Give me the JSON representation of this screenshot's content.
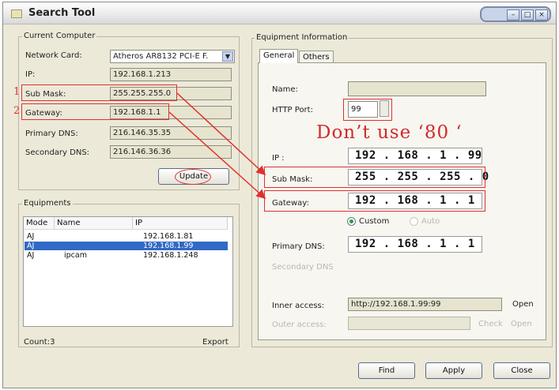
{
  "window": {
    "title": "Search Tool"
  },
  "current_computer": {
    "group_label": "Current Computer",
    "network_card_label": "Network Card:",
    "network_card_value": "Atheros AR8132 PCI-E F.",
    "ip_label": "IP:",
    "ip_value": "192.168.1.213",
    "submask_label": "Sub Mask:",
    "submask_value": "255.255.255.0",
    "gateway_label": "Gateway:",
    "gateway_value": "192.168.1.1",
    "primary_dns_label": "Primary DNS:",
    "primary_dns_value": "216.146.35.35",
    "secondary_dns_label": "Secondary DNS:",
    "secondary_dns_value": "216.146.36.36",
    "update_button": "Update"
  },
  "annotations": {
    "num1": "1",
    "num2": "2",
    "note": "Don’t use ‘80 ‘"
  },
  "equipments": {
    "group_label": "Equipments",
    "columns": [
      "Mode",
      "Name",
      "IP"
    ],
    "rows": [
      {
        "mode": "AJ",
        "name": "",
        "ip": "192.168.1.81"
      },
      {
        "mode": "AJ",
        "name": "",
        "ip": "192.168.1.99"
      },
      {
        "mode": "AJ",
        "name": "ipcam",
        "ip": "192.168.1.248"
      }
    ],
    "selected_row": 1,
    "count_label": "Count:3",
    "export_button": "Export"
  },
  "equipment_info": {
    "group_label": "Equipment Information",
    "tabs": [
      "General",
      "Others"
    ],
    "active_tab": "General",
    "name_label": "Name:",
    "name_value": "",
    "http_port_label": "HTTP Port:",
    "http_port_value": "99",
    "ip_label": "IP :",
    "ip_value": "192 . 168 .  1  . 99",
    "submask_label": "Sub Mask:",
    "submask_value": "255 . 255 . 255 .  0",
    "gateway_label": "Gateway:",
    "gateway_value": "192 . 168 .  1  .  1",
    "custom_radio": "Custom",
    "auto_radio": "Auto",
    "primary_dns_label": "Primary DNS:",
    "primary_dns_value": "192 . 168 .  1  .  1",
    "secondary_dns_label": "Secondary DNS",
    "inner_access_label": "Inner access:",
    "inner_access_value": "http://192.168.1.99:99",
    "open_button": "Open",
    "outer_access_label": "Outer access:",
    "outer_access_value": "",
    "check_button": "Check",
    "outer_open_button": "Open"
  },
  "footer": {
    "find_button": "Find",
    "apply_button": "Apply",
    "close_button": "Close"
  },
  "colors": {
    "annotation_red": "#e03030",
    "selection_blue": "#3169c6",
    "dialog_bg": "#ece9d8"
  }
}
